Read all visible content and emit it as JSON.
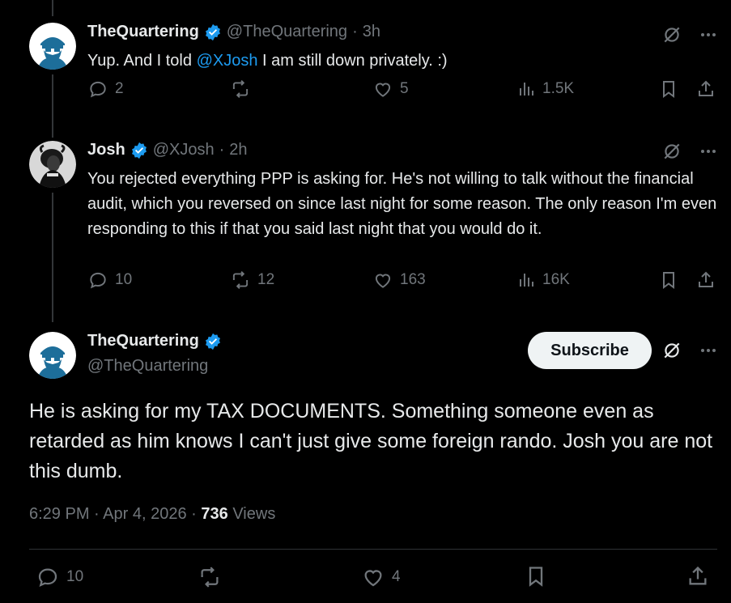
{
  "tweets": [
    {
      "name": "TheQuartering",
      "handle": "@TheQuartering",
      "sep": "·",
      "time": "3h",
      "text_before": "Yup.  And I told ",
      "mention": "@XJosh",
      "text_after": " I am still down privately. :)",
      "replies": "2",
      "reposts": "",
      "likes": "5",
      "views": "1.5K"
    },
    {
      "name": "Josh",
      "handle": "@XJosh",
      "sep": "·",
      "time": "2h",
      "text": "You rejected everything PPP is asking for. He's not willing to talk without the financial audit, which you reversed on since last night for some reason. The only reason I'm even responding to this if that you said last night that you would do it.",
      "replies": "10",
      "reposts": "12",
      "likes": "163",
      "views": "16K"
    }
  ],
  "main_tweet": {
    "name": "TheQuartering",
    "handle": "@TheQuartering",
    "subscribe_label": "Subscribe",
    "text": "He is asking for my TAX DOCUMENTS.  Something someone even as retarded as him knows I can't just give some foreign rando.  Josh you are not this dumb.",
    "time": "6:29 PM",
    "sep1": "·",
    "date": "Apr 4, 2026",
    "sep2": "·",
    "views_count": "736",
    "views_label": "Views",
    "replies": "10",
    "likes": "4"
  },
  "icons": {
    "reply": "reply-bubble-icon",
    "repost": "repost-arrows-icon",
    "like": "heart-icon",
    "views": "analytics-bars-icon",
    "bookmark": "bookmark-icon",
    "share": "share-upload-icon",
    "grok": "grok-slash-circle-icon",
    "more": "more-dots-icon",
    "verified": "verified-badge-icon"
  },
  "colors": {
    "background": "#000000",
    "text": "#e7e9ea",
    "muted": "#71767b",
    "accent": "#1d9bf0",
    "subscribe_bg": "#eff3f4"
  }
}
